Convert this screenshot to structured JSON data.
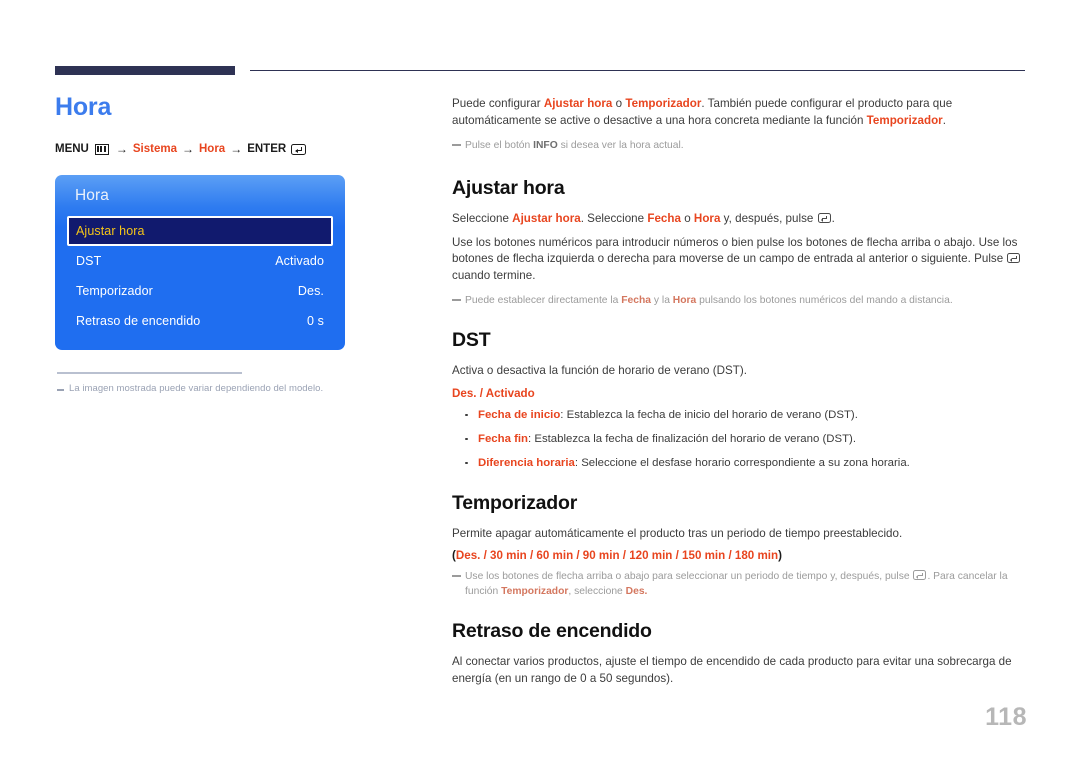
{
  "page_number": "118",
  "left": {
    "title": "Hora",
    "breadcrumb": {
      "menu_label": "MENU",
      "menu_icon": "menu-grid-icon",
      "arrow": "→",
      "item1": "Sistema",
      "item2": "Hora",
      "enter_label": "ENTER",
      "enter_icon": "enter-return-icon"
    },
    "osd": {
      "header": "Hora",
      "rows": [
        {
          "label": "Ajustar hora",
          "value": "",
          "selected": true
        },
        {
          "label": "DST",
          "value": "Activado",
          "selected": false
        },
        {
          "label": "Temporizador",
          "value": "Des.",
          "selected": false
        },
        {
          "label": "Retraso de encendido",
          "value": "0 s",
          "selected": false
        }
      ]
    },
    "model_note": "La imagen mostrada puede variar dependiendo del modelo."
  },
  "right": {
    "intro": {
      "p1_a": "Puede configurar ",
      "p1_b1": "Ajustar hora",
      "p1_c": " o ",
      "p1_b2": "Temporizador",
      "p1_d": ". También puede configurar el producto para que automáticamente se active o desactive a una hora concreta mediante la función ",
      "p1_b3": "Temporizador",
      "p1_e": "."
    },
    "note_info": {
      "a": "Pulse el botón ",
      "b": "INFO",
      "c": " si desea ver la hora actual."
    },
    "section_ajustar": {
      "heading": "Ajustar hora",
      "p1_a": "Seleccione ",
      "p1_b1": "Ajustar hora",
      "p1_c": ". Seleccione ",
      "p1_b2": "Fecha",
      "p1_d": " o ",
      "p1_b3": "Hora",
      "p1_e": " y, después, pulse ",
      "p1_f": ".",
      "p2": "Use los botones numéricos para introducir números o bien pulse los botones de flecha arriba o abajo. Use los botones de flecha izquierda o derecha para moverse de un campo de entrada al anterior o siguiente. Pulse ",
      "p2_tail": " cuando termine.",
      "note_a": "Puede establecer directamente la ",
      "note_b1": "Fecha",
      "note_c": " y la ",
      "note_b2": "Hora",
      "note_d": " pulsando los botones numéricos del mando a distancia."
    },
    "section_dst": {
      "heading": "DST",
      "p1": "Activa o desactiva la función de horario de verano (DST).",
      "options": "Des. / Activado",
      "bullets": [
        {
          "term": "Fecha de inicio",
          "desc": ": Establezca la fecha de inicio del horario de verano (DST)."
        },
        {
          "term": "Fecha fin",
          "desc": ": Establezca la fecha de finalización del horario de verano (DST)."
        },
        {
          "term": "Diferencia horaria",
          "desc": ": Seleccione el desfase horario correspondiente a su zona horaria."
        }
      ]
    },
    "section_temporizador": {
      "heading": "Temporizador",
      "p1": "Permite apagar automáticamente el producto tras un periodo de tiempo preestablecido.",
      "options_open": "(",
      "options": "Des. / 30 min / 60 min / 90 min / 120 min / 150 min / 180 min",
      "options_close": ")",
      "note_a": "Use los botones de flecha arriba o abajo para seleccionar un periodo de tiempo y, después, pulse ",
      "note_b": ". Para cancelar la función ",
      "note_c": "Temporizador",
      "note_d": ", seleccione ",
      "note_e": "Des.",
      "note_f": ""
    },
    "section_retraso": {
      "heading": "Retraso de encendido",
      "p1": "Al conectar varios productos, ajuste el tiempo de encendido de cada producto para evitar una sobrecarga de energía (en un rango de 0 a 50 segundos)."
    }
  },
  "colors": {
    "accent_blue": "#3c7ced",
    "accent_red": "#e8451f",
    "rule_navy": "#2e3254",
    "osd_blue": "#1f6ef0",
    "osd_selected": "#111a6e",
    "osd_selected_text": "#f5c518",
    "page_number": "#b7b7b7"
  }
}
